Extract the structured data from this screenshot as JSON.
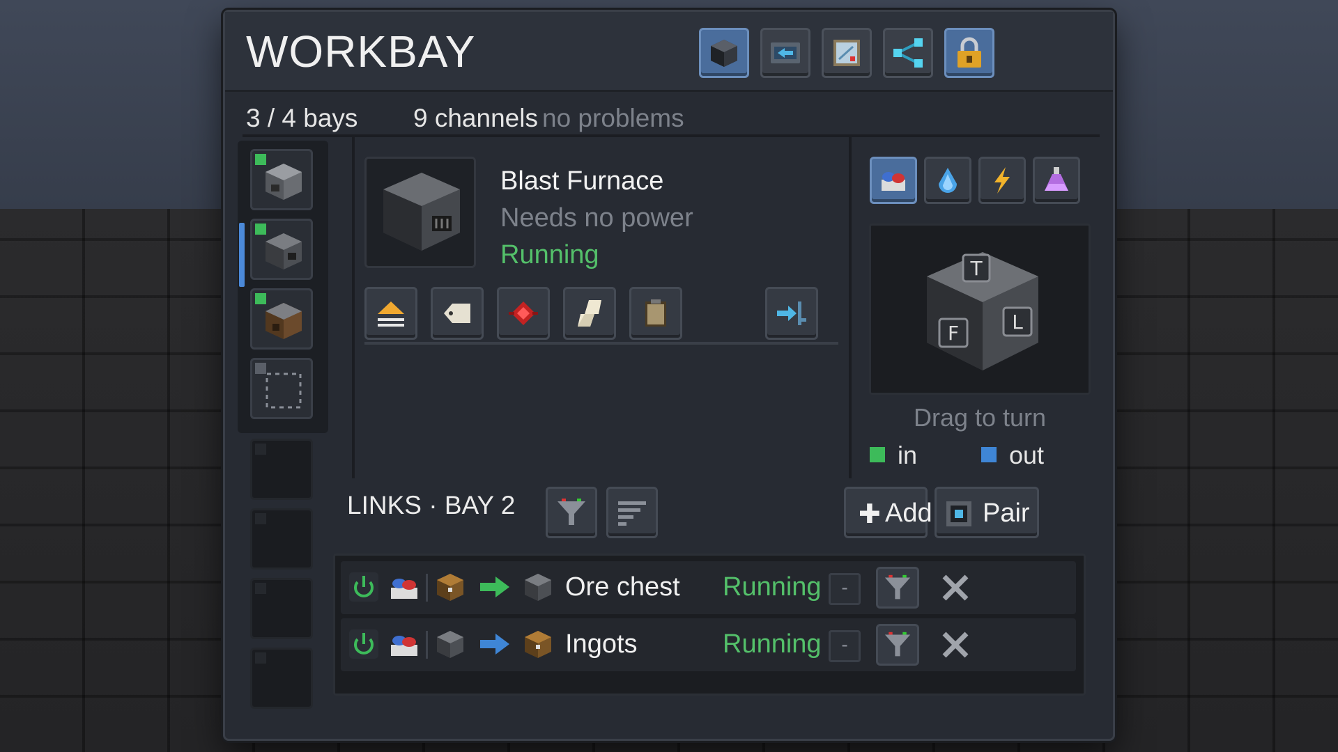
{
  "header": {
    "title": "WORKBAY",
    "buttons": [
      "machine-view",
      "io-view",
      "recipe-view",
      "network-view",
      "lock"
    ]
  },
  "stats": {
    "bays": "3 / 4 bays",
    "channels": "9 channels",
    "problems": "no problems"
  },
  "bays": [
    {
      "state": "active",
      "machine": "furnace"
    },
    {
      "state": "selected",
      "machine": "blast-furnace"
    },
    {
      "state": "active",
      "machine": "smoker"
    },
    {
      "state": "empty-slot"
    },
    {
      "state": "locked"
    },
    {
      "state": "locked"
    },
    {
      "state": "locked"
    },
    {
      "state": "locked"
    }
  ],
  "machine": {
    "name": "Blast Furnace",
    "power": "Needs no power",
    "status": "Running"
  },
  "tools": [
    "eject-icon",
    "label-icon",
    "redstone-icon",
    "paper-icon",
    "clipboard-icon",
    "export-icon"
  ],
  "sides": {
    "tabs": [
      "items-icon",
      "fluid-icon",
      "energy-icon",
      "potion-icon"
    ],
    "face_labels": {
      "top": "T",
      "front": "F",
      "left": "L"
    },
    "drag_hint": "Drag to turn",
    "legend_in": "in",
    "legend_out": "out"
  },
  "links": {
    "title": "LINKS · BAY 2",
    "add_label": "Add",
    "pair_label": "Pair",
    "rows": [
      {
        "name": "Ore chest",
        "status": "Running",
        "minus": "-",
        "direction": "in"
      },
      {
        "name": "Ingots",
        "status": "Running",
        "minus": "-",
        "direction": "out"
      }
    ]
  },
  "colors": {
    "accent": "#4b89d8",
    "running": "#54c06a",
    "in": "#3dbb5a",
    "out": "#3f86d6"
  }
}
